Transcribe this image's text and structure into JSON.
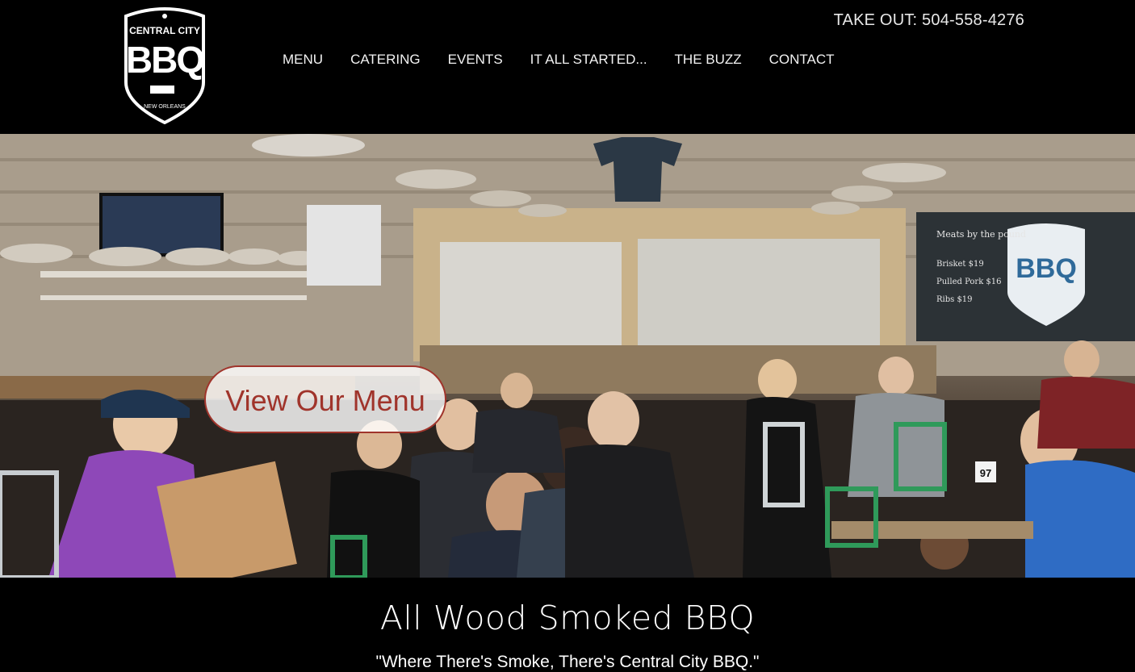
{
  "header": {
    "logo": {
      "top_text": "CENTRAL CITY",
      "main_text": "BBQ",
      "bottom_text": "NEW ORLEANS"
    },
    "takeout": "TAKE OUT: 504-558-4276",
    "nav": [
      {
        "label": "MENU"
      },
      {
        "label": "CATERING"
      },
      {
        "label": "EVENTS"
      },
      {
        "label": "IT ALL STARTED..."
      },
      {
        "label": "THE BUZZ"
      },
      {
        "label": "CONTACT"
      }
    ]
  },
  "hero": {
    "cta_label": "View Our Menu",
    "chalkboard": {
      "heading": "Meats by the pound",
      "logo_text": "BBQ",
      "lines": [
        "Brisket $19",
        "Pulled Pork $16",
        "Ribs $19"
      ]
    },
    "table_number": "97"
  },
  "tagline": {
    "title": "All Wood Smoked BBQ",
    "quote": "\"Where There's Smoke, There's Central City BBQ.\""
  },
  "colors": {
    "background": "#000000",
    "accent": "#a0342b",
    "text": "#ffffff"
  }
}
